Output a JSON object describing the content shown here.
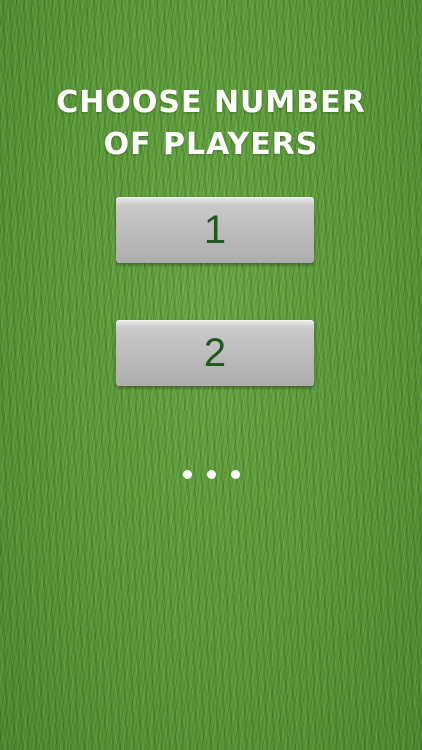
{
  "title": {
    "line1": "CHOOSE NUMBER",
    "line2": "OF PLAYERS"
  },
  "buttons": [
    {
      "label": "1"
    },
    {
      "label": "2"
    }
  ],
  "pagination": {
    "page_count": 3
  },
  "colors": {
    "grass": "#5c9a3a",
    "button_face": "#bdbdbd",
    "button_text": "#1f5a1c",
    "title_text": "#ffffff"
  }
}
